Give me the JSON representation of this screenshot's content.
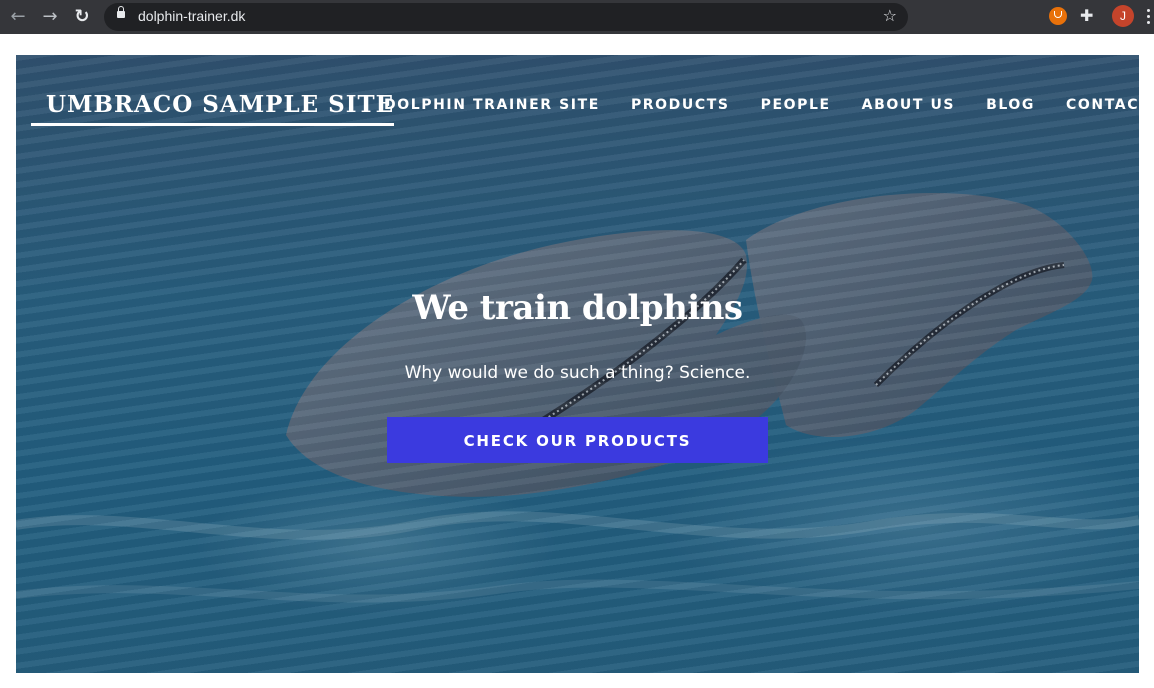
{
  "browser": {
    "url": "dolphin-trainer.dk",
    "avatar_initial": "J",
    "icons": [
      "back-arrow-icon",
      "forward-arrow-icon",
      "reload-icon",
      "lock-icon",
      "star-icon",
      "ublock-icon",
      "puzzle-icon",
      "kebab-menu-icon"
    ]
  },
  "site": {
    "title": "UMBRACO SAMPLE SITE",
    "nav": [
      {
        "label": "DOLPHIN TRAINER SITE"
      },
      {
        "label": "PRODUCTS"
      },
      {
        "label": "PEOPLE"
      },
      {
        "label": "ABOUT US"
      },
      {
        "label": "BLOG"
      },
      {
        "label": "CONTACT"
      }
    ]
  },
  "hero": {
    "title": "We train dolphins",
    "subtitle": "Why would we do such a thing? Science.",
    "cta_label": "CHECK OUR PRODUCTS"
  },
  "colors": {
    "cta": "#3b3adf",
    "chrome": "#35363a",
    "omnibox": "#202124"
  }
}
